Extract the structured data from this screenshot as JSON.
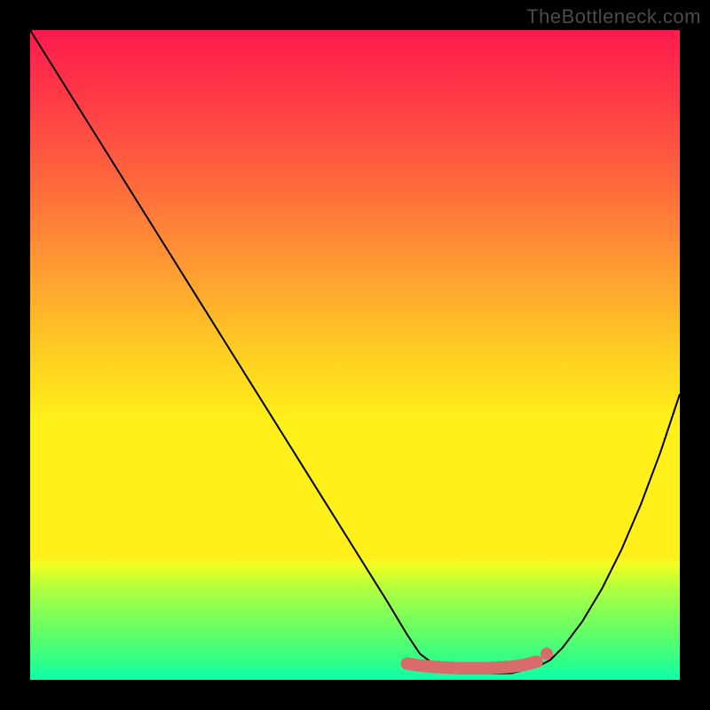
{
  "watermark": "TheBottleneck.com",
  "chart_data": {
    "type": "line",
    "title": "",
    "xlabel": "",
    "ylabel": "",
    "xlim": [
      0,
      100
    ],
    "ylim": [
      0,
      100
    ],
    "grid": false,
    "legend": false,
    "series": [
      {
        "name": "bottleneck-curve",
        "color": "#000000",
        "type": "line",
        "x": [
          0,
          5,
          10,
          15,
          20,
          25,
          30,
          35,
          40,
          45,
          50,
          55,
          58,
          60,
          62,
          64,
          66,
          68,
          70,
          72,
          74,
          76,
          78,
          80,
          82,
          85,
          88,
          91,
          94,
          97,
          100
        ],
        "y": [
          100,
          92,
          84,
          76,
          68,
          60,
          52,
          44,
          36,
          28,
          20,
          12,
          7,
          4,
          2.5,
          1.5,
          1,
          1,
          1,
          1,
          1,
          1.5,
          2,
          3,
          5,
          9,
          14,
          20,
          27,
          35,
          44
        ]
      },
      {
        "name": "minimum-marker",
        "color": "#d96b6b",
        "type": "scatter",
        "x": [
          58,
          60,
          62,
          64,
          66,
          68,
          70,
          72,
          74,
          76,
          78
        ],
        "y": [
          2.5,
          2.2,
          2,
          1.9,
          1.8,
          1.8,
          1.8,
          1.9,
          2,
          2.3,
          2.8
        ]
      },
      {
        "name": "minimum-end-marker",
        "color": "#d96b6b",
        "type": "scatter",
        "x": [
          79.5
        ],
        "y": [
          4
        ]
      }
    ]
  }
}
